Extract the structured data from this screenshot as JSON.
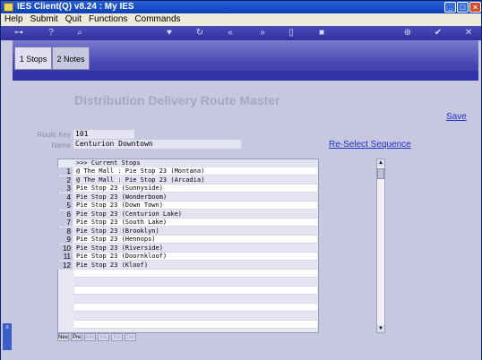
{
  "window": {
    "title": "IES Client(Q) v8.24 : My IES"
  },
  "menu": [
    "Help",
    "Submit",
    "Quit",
    "Functions",
    "Commands"
  ],
  "tabs": [
    {
      "label": "1 Stops"
    },
    {
      "label": "2 Notes"
    }
  ],
  "page": {
    "title": "Distribution Delivery Route Master",
    "save_link": "Save",
    "reselect_link": "Re-Select Sequence"
  },
  "form": {
    "route_key_label": "Route Key",
    "route_key_value": "101",
    "name_label": "Name",
    "name_value": "Centurion Downtown"
  },
  "grid": {
    "header": ">>> Current Stops",
    "rows": [
      {
        "num": "1",
        "text": "@ The Mall : Pie Stop 23 (Montana)"
      },
      {
        "num": "2",
        "text": "@ The Mall : Pie Stop 23 (Arcadia)"
      },
      {
        "num": "3",
        "text": "Pie Stop 23 (Sunnyside)"
      },
      {
        "num": "4",
        "text": "Pie Stop 23 (Wonderboom)"
      },
      {
        "num": "5",
        "text": "Pie Stop 23 (Down Town)"
      },
      {
        "num": "6",
        "text": "Pie Stop 23 (Centurion Lake)"
      },
      {
        "num": "7",
        "text": "Pie Stop 23 (South Lake)"
      },
      {
        "num": "8",
        "text": "Pie Stop 23 (Brooklyn)"
      },
      {
        "num": "9",
        "text": "Pie Stop 23 (Hennops)"
      },
      {
        "num": "10",
        "text": "Pie Stop 23 (Riverside)"
      },
      {
        "num": "11",
        "text": "Pie Stop 23 (Doornkloof)"
      },
      {
        "num": "12",
        "text": "Pie Stop 23 (Kloof)"
      }
    ]
  },
  "grid_buttons": [
    "Nex",
    "Pre",
    "Add",
    "Ins",
    "Ed",
    "Del"
  ]
}
